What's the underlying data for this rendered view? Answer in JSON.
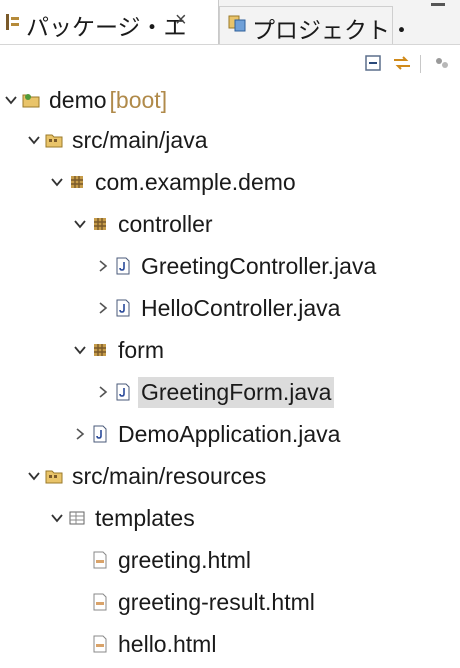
{
  "tabs": {
    "active_label": "パッケージ・エ",
    "close_glyph": "×",
    "inactive_label": "プロジェクト・"
  },
  "tree": [
    {
      "label": "demo",
      "decoration": "[boot]",
      "icon": "project-icon",
      "expanded": true
    },
    {
      "label": "src/main/java",
      "icon": "source-folder-icon",
      "expanded": true
    },
    {
      "label": "com.example.demo",
      "icon": "package-icon",
      "expanded": true
    },
    {
      "label": "controller",
      "icon": "package-icon",
      "expanded": true
    },
    {
      "label": "GreetingController.java",
      "icon": "java-file-icon",
      "expanded": false
    },
    {
      "label": "HelloController.java",
      "icon": "java-file-icon",
      "expanded": false
    },
    {
      "label": "form",
      "icon": "package-icon",
      "expanded": true
    },
    {
      "label": "GreetingForm.java",
      "icon": "java-file-icon",
      "expanded": false,
      "selected": true
    },
    {
      "label": "DemoApplication.java",
      "icon": "java-file-icon",
      "expanded": false
    },
    {
      "label": "src/main/resources",
      "icon": "source-folder-icon",
      "expanded": true
    },
    {
      "label": "templates",
      "icon": "folder-icon",
      "expanded": true
    },
    {
      "label": "greeting.html",
      "icon": "html-file-icon"
    },
    {
      "label": "greeting-result.html",
      "icon": "html-file-icon"
    },
    {
      "label": "hello.html",
      "icon": "html-file-icon"
    }
  ]
}
